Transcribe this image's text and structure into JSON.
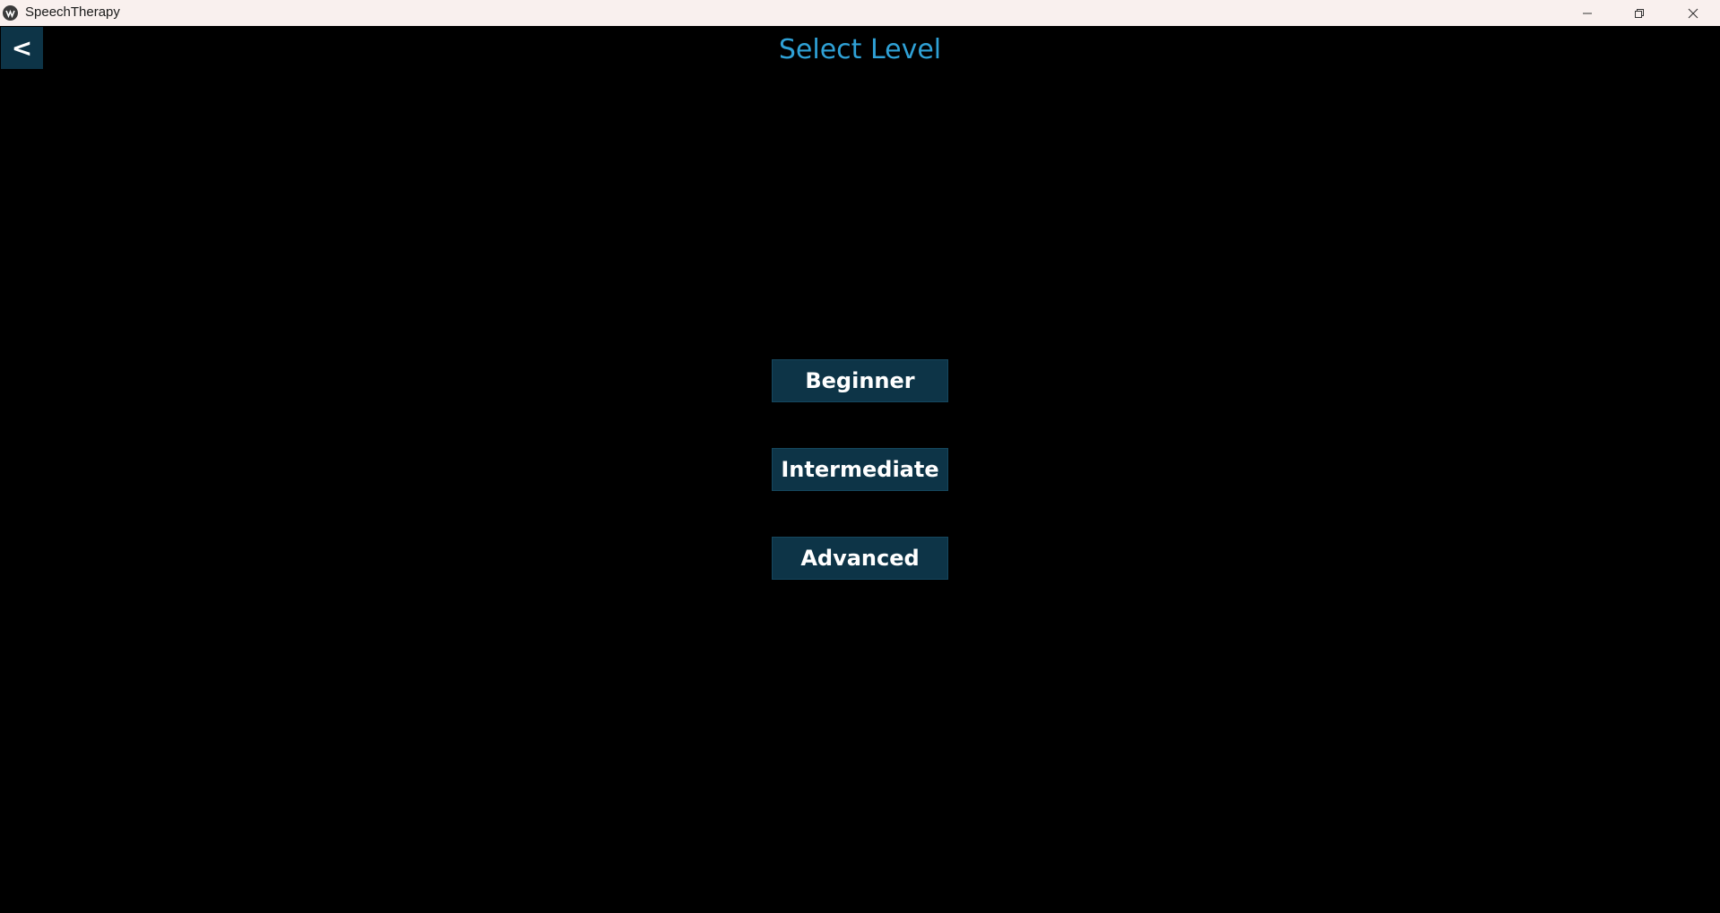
{
  "window": {
    "title": "SpeechTherapy",
    "controls": {
      "minimize_icon": "minimize-icon",
      "maximize_icon": "restore-icon",
      "close_icon": "close-icon"
    }
  },
  "header": {
    "back_label": "<",
    "title": "Select Level"
  },
  "levels": [
    {
      "label": "Beginner"
    },
    {
      "label": "Intermediate"
    },
    {
      "label": "Advanced"
    }
  ],
  "colors": {
    "background": "#000000",
    "titlebar": "#f9f0ee",
    "button_bg": "#0d3447",
    "title_text": "#2fa1d6",
    "button_text": "#ffffff"
  }
}
